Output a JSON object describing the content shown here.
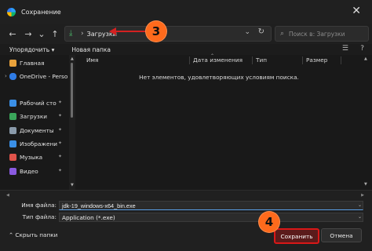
{
  "window": {
    "title": "Сохранение",
    "close_glyph": "✕"
  },
  "nav": {
    "back": "←",
    "forward": "→",
    "recent": "⌄",
    "up": "↑",
    "breadcrumb_sep": "›",
    "breadcrumb": "Загрузки",
    "chevron": "⌄",
    "refresh": "↻",
    "search_placeholder": "Поиск в: Загрузки"
  },
  "commandbar": {
    "organize": "Упорядочить ▾",
    "new_folder": "Новая папка",
    "view_glyph": "☰",
    "help_glyph": "?"
  },
  "sidebar": {
    "items": [
      {
        "label": "Главная",
        "icon": "home-icon",
        "color": "#e9a23b"
      },
      {
        "label": "OneDrive - Perso",
        "icon": "cloud-icon",
        "color": "#2f7ce6",
        "expander": "›"
      },
      {
        "label": "Рабочий сто",
        "icon": "desktop-icon",
        "color": "#3a8fe6",
        "pin": "📌"
      },
      {
        "label": "Загрузки",
        "icon": "download-icon",
        "color": "#3aa65a",
        "pin": "📌"
      },
      {
        "label": "Документы",
        "icon": "documents-icon",
        "color": "#8a9aaa",
        "pin": "📌"
      },
      {
        "label": "Изображени",
        "icon": "pictures-icon",
        "color": "#3a8fe6",
        "pin": "📌"
      },
      {
        "label": "Музыка",
        "icon": "music-icon",
        "color": "#e0534a",
        "pin": "📌"
      },
      {
        "label": "Видео",
        "icon": "video-icon",
        "color": "#8a5ae0",
        "pin": "📌"
      }
    ]
  },
  "filelist": {
    "columns": [
      "Имя",
      "Дата изменения",
      "Тип",
      "Размер"
    ],
    "sort_glyph": "⌃",
    "empty_message": "Нет элементов, удовлетворяющих условиям поиска."
  },
  "form": {
    "filename_label": "Имя файла:",
    "filename_value": "jdk-19_windows-x64_bin.exe",
    "filetype_label": "Тип файла:",
    "filetype_value": "Application (*.exe)",
    "dropdown_glyph": "⌄"
  },
  "footer": {
    "hide_folders": "⌃ Скрыть папки",
    "save": "Сохранить",
    "cancel": "Отмена"
  },
  "annotations": {
    "step3": "3",
    "step4": "4",
    "accent": "#d42121",
    "badge_color": "#ff6a1c"
  }
}
